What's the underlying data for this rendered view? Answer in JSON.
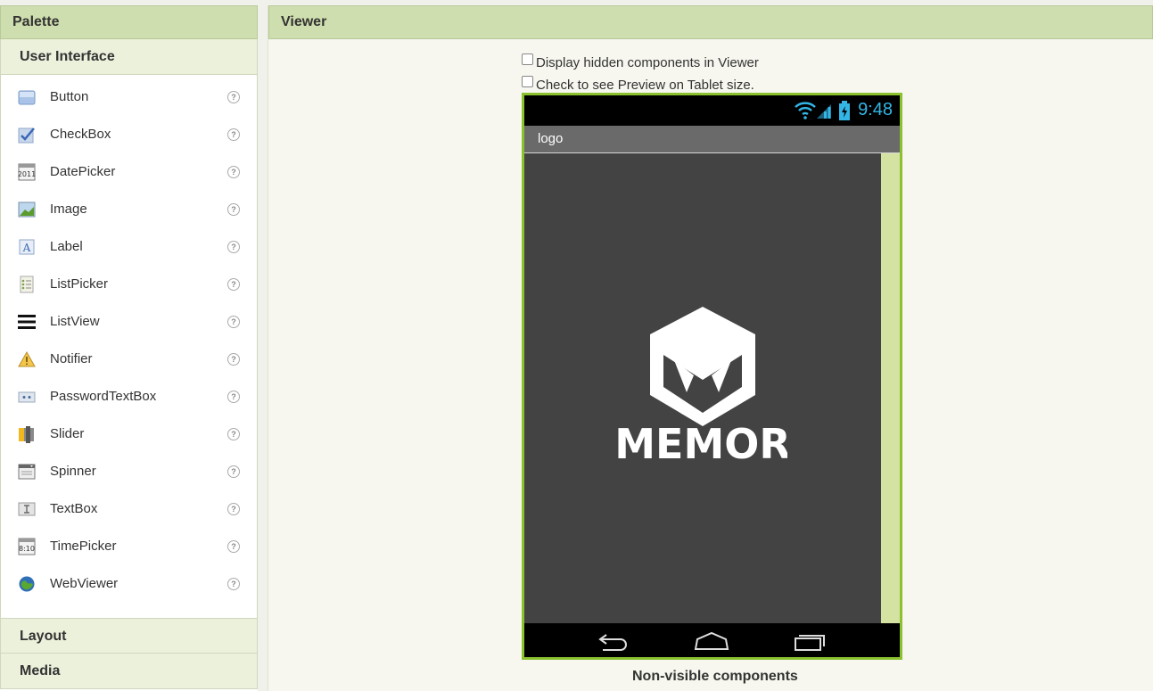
{
  "palette": {
    "title": "Palette",
    "sections": {
      "user_interface": "User Interface",
      "layout": "Layout",
      "media": "Media"
    },
    "help_glyph": "?",
    "items": [
      {
        "label": "Button",
        "icon": "button-icon"
      },
      {
        "label": "CheckBox",
        "icon": "checkbox-icon"
      },
      {
        "label": "DatePicker",
        "icon": "datepicker-icon"
      },
      {
        "label": "Image",
        "icon": "image-icon"
      },
      {
        "label": "Label",
        "icon": "label-icon"
      },
      {
        "label": "ListPicker",
        "icon": "listpicker-icon"
      },
      {
        "label": "ListView",
        "icon": "listview-icon"
      },
      {
        "label": "Notifier",
        "icon": "notifier-icon"
      },
      {
        "label": "PasswordTextBox",
        "icon": "passwordtextbox-icon"
      },
      {
        "label": "Slider",
        "icon": "slider-icon"
      },
      {
        "label": "Spinner",
        "icon": "spinner-icon"
      },
      {
        "label": "TextBox",
        "icon": "textbox-icon"
      },
      {
        "label": "TimePicker",
        "icon": "timepicker-icon"
      },
      {
        "label": "WebViewer",
        "icon": "webviewer-icon"
      }
    ]
  },
  "viewer": {
    "title": "Viewer",
    "options": {
      "hidden_components": "Display hidden components in Viewer",
      "tablet_preview": "Check to see Preview on Tablet size."
    },
    "phone": {
      "status_time": "9:48",
      "screen_title": "logo",
      "logo_text": "MEMOR"
    },
    "non_visible": "Non-visible components"
  },
  "colors": {
    "header": "#cfdeae",
    "phone_border": "#8bc12f",
    "status_accent": "#33b5e5",
    "screen_bg": "#434343"
  }
}
